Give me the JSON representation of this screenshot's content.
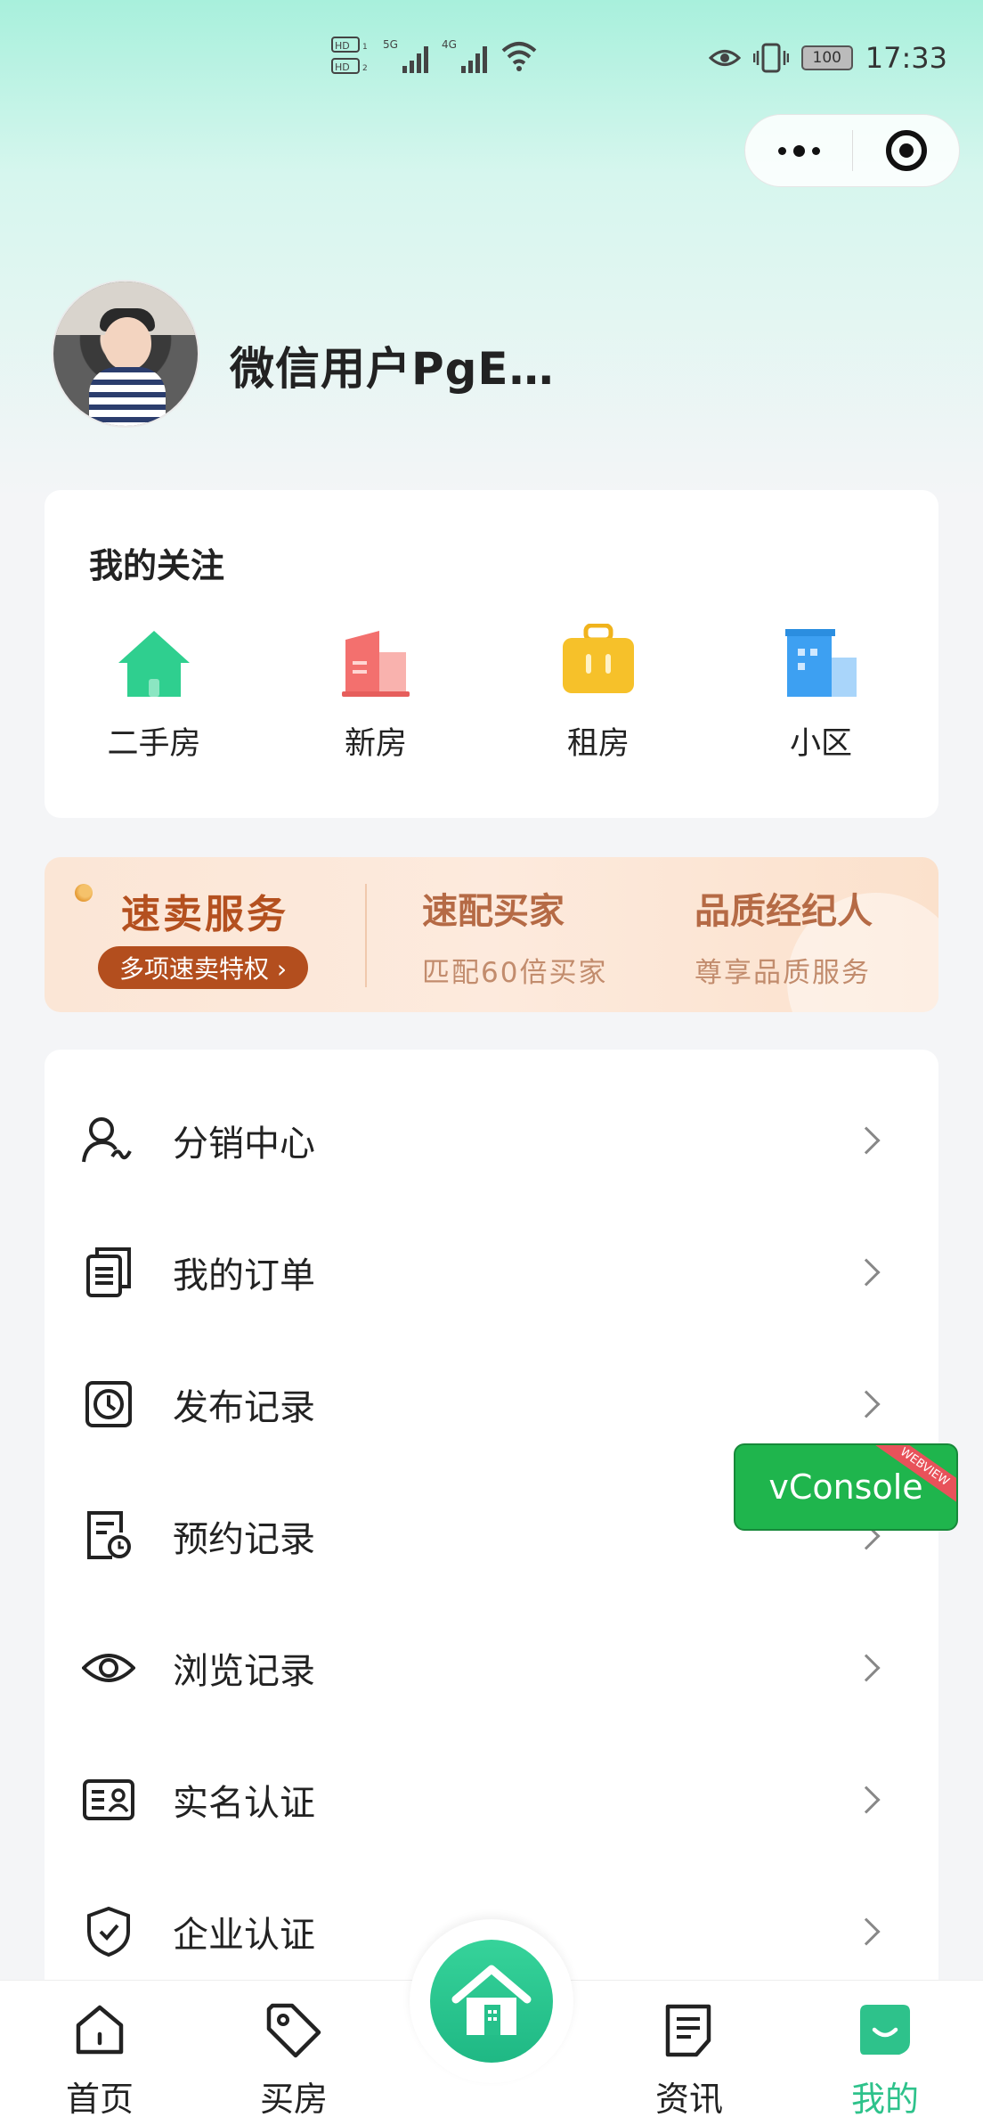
{
  "status_bar": {
    "network": [
      "HD1",
      "HD2",
      "5G",
      "4G"
    ],
    "battery": "100",
    "time": "17:33"
  },
  "profile": {
    "username": "微信用户PgE…"
  },
  "favorites": {
    "title": "我的关注",
    "items": [
      {
        "label": "二手房",
        "icon": "house-icon",
        "color": "#2fcf8f"
      },
      {
        "label": "新房",
        "icon": "building-icon",
        "color": "#f3706e"
      },
      {
        "label": "租房",
        "icon": "suitcase-icon",
        "color": "#f6c12a"
      },
      {
        "label": "小区",
        "icon": "community-icon",
        "color": "#3da0f2"
      }
    ]
  },
  "banner": {
    "main_title": "速卖服务",
    "pill_label": "多项速卖特权 ›",
    "col1_title": "速配买家",
    "col1_sub": "匹配60倍买家",
    "col2_title": "品质经纪人",
    "col2_sub": "尊享品质服务"
  },
  "menu": [
    {
      "label": "分销中心",
      "icon": "distributor-icon"
    },
    {
      "label": "我的订单",
      "icon": "order-icon"
    },
    {
      "label": "发布记录",
      "icon": "clock-icon"
    },
    {
      "label": "预约记录",
      "icon": "appointment-icon"
    },
    {
      "label": "浏览记录",
      "icon": "eye-icon"
    },
    {
      "label": "实名认证",
      "icon": "id-card-icon"
    },
    {
      "label": "企业认证",
      "icon": "shield-icon"
    }
  ],
  "vconsole": {
    "label": "vConsole",
    "ribbon": "WEBVIEW"
  },
  "tabbar": {
    "tabs": [
      {
        "label": "首页",
        "icon": "home-icon"
      },
      {
        "label": "买房",
        "icon": "tag-icon"
      },
      {
        "label": "资讯",
        "icon": "news-icon"
      },
      {
        "label": "我的",
        "icon": "profile-icon",
        "active": true
      }
    ],
    "accent": "#2ec28b"
  }
}
